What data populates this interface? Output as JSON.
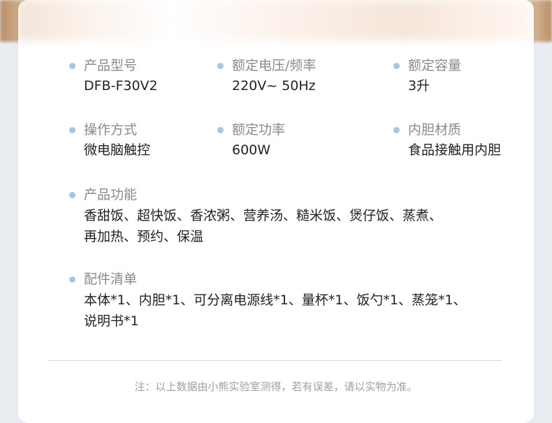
{
  "specs": [
    {
      "label": "产品型号",
      "value": "DFB-F30V2"
    },
    {
      "label": "额定电压/频率",
      "value": "220V~ 50Hz"
    },
    {
      "label": "额定容量",
      "value": "3升"
    },
    {
      "label": "操作方式",
      "value": "微电脑触控"
    },
    {
      "label": "额定功率",
      "value": "600W"
    },
    {
      "label": "内胆材质",
      "value": "食品接触用内胆"
    }
  ],
  "functions": {
    "label": "产品功能",
    "line1": "香甜饭、超快饭、香浓粥、营养汤、糙米饭、煲仔饭、蒸煮、",
    "line2": "再加热、预约、保温"
  },
  "accessories": {
    "label": "配件清单",
    "line1": "本体*1、内胆*1、可分离电源线*1、量杯*1、饭勺*1、蒸笼*1、",
    "line2": "说明书*1"
  },
  "note": "注：以上数据由小熊实验室测得，若有误差，请以实物为准。",
  "colors": {
    "bullet": "#a9c5de",
    "label": "#8a8a8a",
    "value": "#222222",
    "note": "#a0a0a0"
  }
}
